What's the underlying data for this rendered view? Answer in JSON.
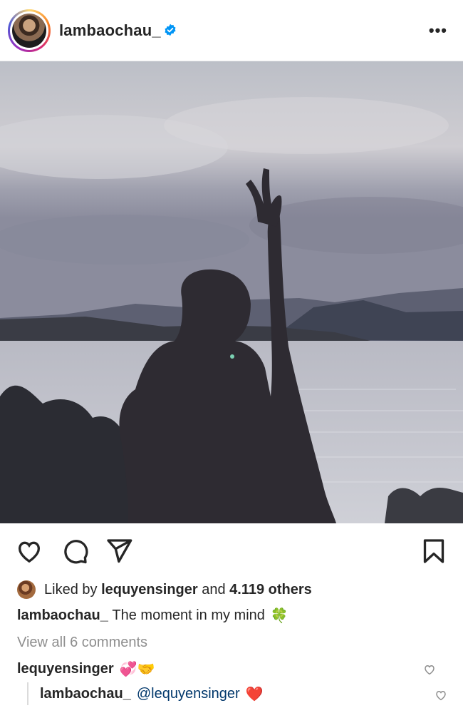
{
  "post": {
    "username": "lambaochau_",
    "verified": true,
    "more_label": "•••"
  },
  "actions": {
    "like_icon": "heart-outline-icon",
    "comment_icon": "comment-bubble-icon",
    "share_icon": "paper-plane-icon",
    "save_icon": "bookmark-icon"
  },
  "likes": {
    "prefix": "Liked by",
    "user": "lequyensinger",
    "middle": "and",
    "count": "4.119 others"
  },
  "caption": {
    "username": "lambaochau_",
    "text": "The moment in my mind",
    "emoji": "🍀"
  },
  "comments": {
    "view_all": "View all 6 comments",
    "first": {
      "username": "lequyensinger",
      "emoji": "💞🤝"
    },
    "reply": {
      "username": "lambaochau_",
      "mention": "@lequyensinger",
      "emoji": "❤️"
    }
  },
  "colors": {
    "accent_blue": "#0095f6",
    "mention_blue": "#00376b",
    "muted": "#8e8e8e",
    "heart_red": "#e0245e"
  }
}
